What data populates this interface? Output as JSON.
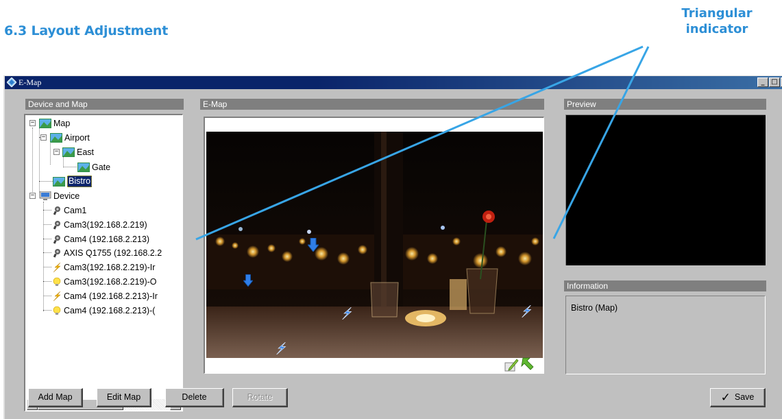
{
  "document": {
    "heading": "6.3 Layout Adjustment",
    "callout": {
      "line1": "Triangular",
      "line2": "indicator"
    }
  },
  "window": {
    "title": "E-Map",
    "controls": {
      "minimize": "_",
      "maximize": "□",
      "close": "×"
    }
  },
  "panels": {
    "device_and_map": "Device and Map",
    "emap": "E-Map",
    "preview": "Preview",
    "information": "Information"
  },
  "tree": {
    "map": {
      "label": "Map",
      "children": [
        {
          "label": "Airport"
        },
        {
          "label": "East"
        },
        {
          "label": "Gate"
        },
        {
          "label": "Bistro",
          "selected": true
        }
      ]
    },
    "device": {
      "label": "Device",
      "children": [
        {
          "label": "Cam1",
          "icon": "camera-icon"
        },
        {
          "label": "Cam3(192.168.2.219)",
          "icon": "camera-icon"
        },
        {
          "label": "Cam4 (192.168.2.213)",
          "icon": "camera-icon"
        },
        {
          "label": "AXIS Q1755 (192.168.2.2",
          "icon": "camera-icon"
        },
        {
          "label": "Cam3(192.168.2.219)-Ir",
          "icon": "input-bolt-icon"
        },
        {
          "label": "Cam3(192.168.2.219)-O",
          "icon": "output-bulb-icon"
        },
        {
          "label": "Cam4 (192.168.2.213)-Ir",
          "icon": "input-bolt-icon"
        },
        {
          "label": "Cam4 (192.168.2.213)-(",
          "icon": "output-bulb-icon"
        }
      ]
    }
  },
  "information": {
    "text": "Bistro (Map)"
  },
  "buttons": {
    "add_map": "Add Map",
    "edit_map": "Edit Map",
    "delete": "Delete",
    "rotate": "Rotate",
    "save": "Save"
  },
  "colors": {
    "heading_blue": "#2d8fd6",
    "titlebar": "#0a246a",
    "window_gray": "#c0c0c0",
    "panel_header": "#7f7f7f"
  }
}
